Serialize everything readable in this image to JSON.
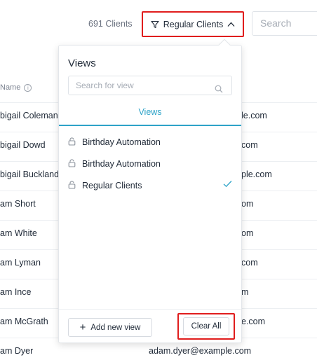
{
  "toolbar": {
    "client_count": "691 Clients",
    "view_button_label": "Regular Clients",
    "search_placeholder": "Search"
  },
  "table": {
    "column_header": "Name",
    "rows": [
      {
        "name": "bigail Coleman",
        "email": "le.com"
      },
      {
        "name": "bigail Dowd",
        "email": "com"
      },
      {
        "name": "bigail Buckland",
        "email": "ple.com"
      },
      {
        "name": "am Short",
        "email": "om"
      },
      {
        "name": "am White",
        "email": "om"
      },
      {
        "name": "am Lyman",
        "email": "com"
      },
      {
        "name": "am Ince",
        "email": "m"
      },
      {
        "name": "am McGrath",
        "email": "e.com"
      },
      {
        "name": "am Dyer",
        "email": "adam.dyer@example.com"
      }
    ]
  },
  "views_panel": {
    "title": "Views",
    "search_placeholder": "Search for view",
    "tab_label": "Views",
    "items": [
      {
        "label": "Birthday Automation",
        "selected": false
      },
      {
        "label": "Birthday Automation",
        "selected": false
      },
      {
        "label": "Regular Clients",
        "selected": true
      }
    ],
    "add_button_label": "Add new view",
    "clear_button_label": "Clear All"
  },
  "colors": {
    "accent": "#2ea3c8",
    "highlight_border": "#e01d1d"
  }
}
